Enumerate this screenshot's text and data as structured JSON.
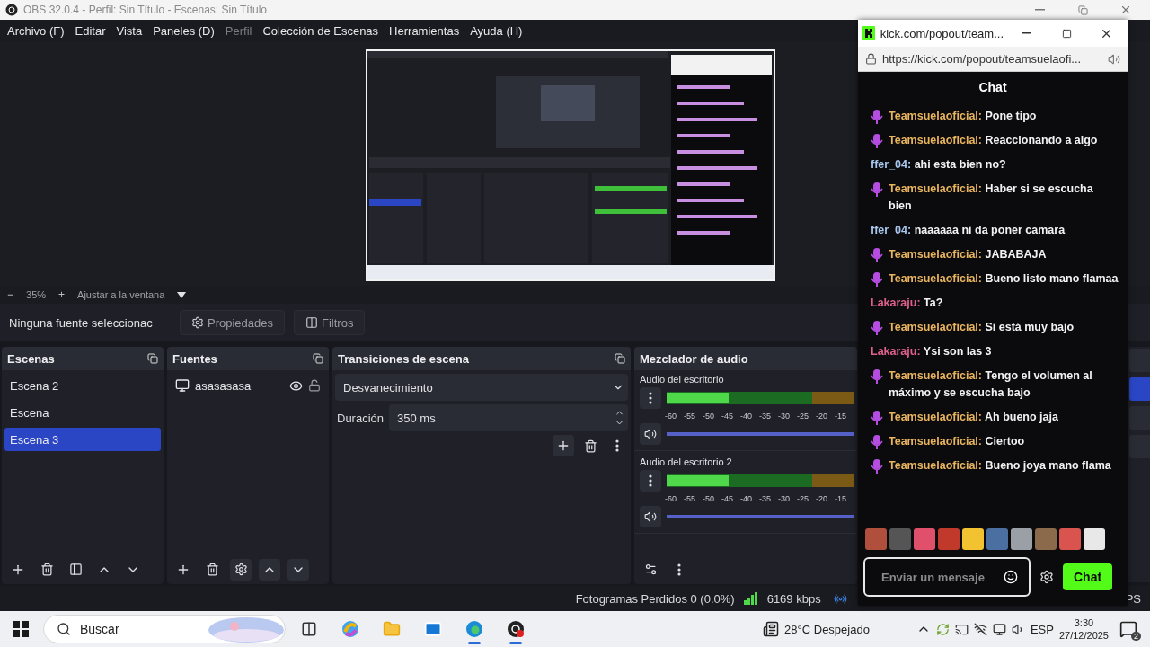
{
  "window": {
    "title": "OBS 32.0.4 - Perfil: Sin Título - Escenas: Sin Título"
  },
  "menu": [
    {
      "label": "Archivo (F)",
      "disabled": false
    },
    {
      "label": "Editar",
      "disabled": false
    },
    {
      "label": "Vista",
      "disabled": false
    },
    {
      "label": "Paneles (D)",
      "disabled": false
    },
    {
      "label": "Perfil",
      "disabled": true
    },
    {
      "label": "Colección de Escenas",
      "disabled": false
    },
    {
      "label": "Herramientas",
      "disabled": false
    },
    {
      "label": "Ayuda (H)",
      "disabled": false
    }
  ],
  "zoom_bar": {
    "minus": "−",
    "zoom": "35%",
    "plus": "+",
    "fit": "Ajustar a la ventana"
  },
  "context_bar": {
    "status": "Ninguna fuente seleccionac",
    "buttons": [
      {
        "label": "Propiedades",
        "kind": "gear"
      },
      {
        "label": "Filtros",
        "kind": "filter"
      }
    ]
  },
  "scenes": {
    "title": "Escenas",
    "items": [
      {
        "label": "Escena 2",
        "selected": false
      },
      {
        "label": "Escena",
        "selected": false
      },
      {
        "label": "Escena 3",
        "selected": true
      }
    ]
  },
  "sources": {
    "title": "Fuentes",
    "items": [
      {
        "label": "asasasasa",
        "visible": true,
        "locked": false
      }
    ]
  },
  "transitions": {
    "title": "Transiciones de escena",
    "selected": "Desvanecimiento",
    "duration_label": "Duración",
    "duration": "350 ms"
  },
  "mixer": {
    "title": "Mezclador de audio",
    "channels": [
      {
        "name": "Audio del escritorio",
        "level": 0.33,
        "muted": false,
        "volume": {
          "level": 1
        },
        "ticks": [
          "-60",
          "-55",
          "-50",
          "-45",
          "-40",
          "-35",
          "-30",
          "-25",
          "-20",
          "-15"
        ]
      },
      {
        "name": "Audio del escritorio 2",
        "level": 0.33,
        "muted": false,
        "volume": {
          "level": 1
        },
        "ticks": [
          "-60",
          "-55",
          "-50",
          "-45",
          "-40",
          "-35",
          "-30",
          "-25",
          "-20",
          "-15"
        ]
      }
    ]
  },
  "status_bar": {
    "dropped": "Fotogramas Perdidos 0 (0.0%)",
    "bitrate": "6169 kbps",
    "edge": "PS"
  },
  "chat_window": {
    "title": "kick.com/popout/team...",
    "url": "https://kick.com/popout/teamsuelaofi...",
    "header": "Chat",
    "messages": [
      {
        "user": "Teamsuelaoficial:",
        "text": "Pone tipo",
        "color": "#e9b45f",
        "kind": "mod"
      },
      {
        "user": "Teamsuelaoficial:",
        "text": "Reaccionando a algo",
        "color": "#e9b45f",
        "kind": "mod"
      },
      {
        "user": "ffer_04:",
        "text": "ahi esta bien no?",
        "color": "#a9c9f0",
        "kind": "plain"
      },
      {
        "user": "Teamsuelaoficial:",
        "text": "Haber si se escucha bien",
        "color": "#e9b45f",
        "kind": "mod"
      },
      {
        "user": "ffer_04:",
        "text": "naaaaaa ni da poner camara",
        "color": "#a9c9f0",
        "kind": "plain"
      },
      {
        "user": "Teamsuelaoficial:",
        "text": "JABABAJA",
        "color": "#e9b45f",
        "kind": "mod"
      },
      {
        "user": "Teamsuelaoficial:",
        "text": "Bueno listo mano flamaa",
        "color": "#e9b45f",
        "kind": "mod"
      },
      {
        "user": "Lakaraju:",
        "text": "Ta?",
        "color": "#e0608c",
        "kind": "plain"
      },
      {
        "user": "Teamsuelaoficial:",
        "text": "Si está muy bajo",
        "color": "#e9b45f",
        "kind": "mod"
      },
      {
        "user": "Lakaraju:",
        "text": "Ysi son las 3",
        "color": "#e0608c",
        "kind": "plain"
      },
      {
        "user": "Teamsuelaoficial:",
        "text": "Tengo el volumen al máximo y se escucha bajo",
        "color": "#e9b45f",
        "kind": "mod"
      },
      {
        "user": "Teamsuelaoficial:",
        "text": "Ah bueno jaja",
        "color": "#e9b45f",
        "kind": "mod"
      },
      {
        "user": "Teamsuelaoficial:",
        "text": "Ciertoo",
        "color": "#e9b45f",
        "kind": "mod"
      },
      {
        "user": "Teamsuelaoficial:",
        "text": "Bueno joya mano flama",
        "color": "#e9b45f",
        "kind": "mod"
      }
    ],
    "emotes": [
      {
        "color": "#b0503c"
      },
      {
        "color": "#555555"
      },
      {
        "color": "#e0506a"
      },
      {
        "color": "#c0392b"
      },
      {
        "color": "#f2c230"
      },
      {
        "color": "#4a6fa0"
      },
      {
        "color": "#9aa0a6"
      },
      {
        "color": "#8a6a4a"
      },
      {
        "color": "#d9534f"
      },
      {
        "color": "#e8e8e8"
      }
    ],
    "input": {
      "placeholder": "Enviar un mensaje"
    },
    "send": "Chat"
  },
  "taskbar": {
    "search": "Buscar",
    "apps": [
      {
        "kind": "taskview",
        "active": false
      },
      {
        "kind": "copilot",
        "active": false
      },
      {
        "kind": "explorer",
        "active": false
      },
      {
        "kind": "mail",
        "active": false
      },
      {
        "kind": "edge",
        "active": true
      },
      {
        "kind": "obs",
        "active": true
      }
    ],
    "weather": "28°C  Despejado",
    "language": "ESP",
    "time": "3:30",
    "date": "27/12/2025",
    "notifications": "2"
  }
}
